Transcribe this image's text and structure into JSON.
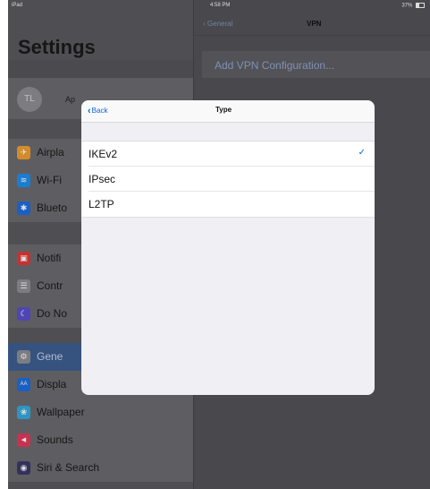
{
  "status_bar": {
    "device": "iPad",
    "time": "4:58 PM",
    "battery": "37%"
  },
  "settings": {
    "title": "Settings",
    "profile": {
      "initials": "TL",
      "name_partial": "Ap"
    },
    "group1": [
      {
        "label": "Airpla",
        "icon": "airplane-icon",
        "color": "#f0a030",
        "glyph": "✈"
      },
      {
        "label": "Wi-Fi",
        "icon": "wifi-icon",
        "color": "#1e8ef0",
        "glyph": "≋"
      },
      {
        "label": "Blueto",
        "icon": "bluetooth-icon",
        "color": "#1e6ee0",
        "glyph": "✱"
      }
    ],
    "group2": [
      {
        "label": "Notifi",
        "icon": "notifications-icon",
        "color": "#e23a3a",
        "glyph": "▣"
      },
      {
        "label": "Contr",
        "icon": "control-center-icon",
        "color": "#8e8e93",
        "glyph": "☰"
      },
      {
        "label": "Do No",
        "icon": "moon-icon",
        "color": "#5a4fcf",
        "glyph": "☾"
      }
    ],
    "group3": [
      {
        "label": "Gene",
        "icon": "gear-icon",
        "color": "#8e8e93",
        "glyph": "⚙",
        "selected": true
      },
      {
        "label": "Displa",
        "icon": "display-icon",
        "color": "#1e6ee0",
        "glyph": "AA"
      },
      {
        "label": "Wallpaper",
        "icon": "wallpaper-icon",
        "color": "#35aadc",
        "glyph": "❀"
      },
      {
        "label": "Sounds",
        "icon": "sounds-icon",
        "color": "#e23a5a",
        "glyph": "◀"
      },
      {
        "label": "Siri & Search",
        "icon": "siri-icon",
        "color": "#3a3a6a",
        "glyph": "◉"
      }
    ]
  },
  "vpn": {
    "back_label": "General",
    "title": "VPN",
    "add_config_label": "Add VPN Configuration..."
  },
  "type_popover": {
    "back_label": "Back",
    "title": "Type",
    "options": [
      {
        "label": "IKEv2",
        "checked": true
      },
      {
        "label": "IPsec",
        "checked": false
      },
      {
        "label": "L2TP",
        "checked": false
      }
    ],
    "check_glyph": "✓"
  }
}
